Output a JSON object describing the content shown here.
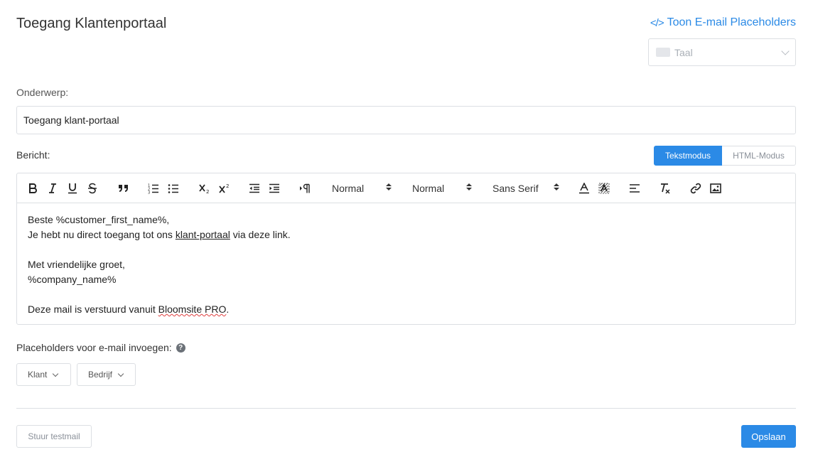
{
  "header": {
    "title": "Toegang Klantenportaal",
    "placeholders_link": "Toon E-mail Placeholders",
    "placeholders_icon": "code-icon",
    "language_select": {
      "placeholder": "Taal"
    }
  },
  "subject": {
    "label": "Onderwerp:",
    "value": "Toegang klant-portaal"
  },
  "message": {
    "label": "Bericht:",
    "modes": [
      "Tekstmodus",
      "HTML-Modus"
    ],
    "active_mode": "Tekstmodus"
  },
  "toolbar": {
    "buttons": [
      "bold-icon",
      "italic-icon",
      "underline-icon",
      "strikethrough-icon",
      "blockquote-icon",
      "ordered-list-icon",
      "bullet-list-icon",
      "subscript-icon",
      "superscript-icon",
      "outdent-icon",
      "indent-icon",
      "text-direction-icon",
      "text-color-icon",
      "background-color-icon",
      "align-icon",
      "clear-format-icon",
      "link-icon",
      "image-icon"
    ],
    "header_select": "Normal",
    "size_select": "Normal",
    "font_select": "Sans Serif"
  },
  "body": {
    "line1": "Beste %customer_first_name%,",
    "line2_before": "Je hebt nu direct toegang tot ons ",
    "line2_link": "klant-portaal",
    "line2_after": " via deze link.",
    "line3": "Met vriendelijke groet,",
    "line4": "%company_name%",
    "line5_before": "Deze mail is verstuurd vanuit ",
    "line5_link": " Bloomsite PRO",
    "line5_after": "."
  },
  "placeholders": {
    "label": "Placeholders voor e-mail invoegen:",
    "help_icon": "help-icon",
    "buttons": [
      "Klant",
      "Bedrijf"
    ]
  },
  "footer": {
    "test_button": "Stuur testmail",
    "save_button": "Opslaan"
  },
  "colors": {
    "accent": "#2b8ae6",
    "border": "#dcdfe3"
  }
}
